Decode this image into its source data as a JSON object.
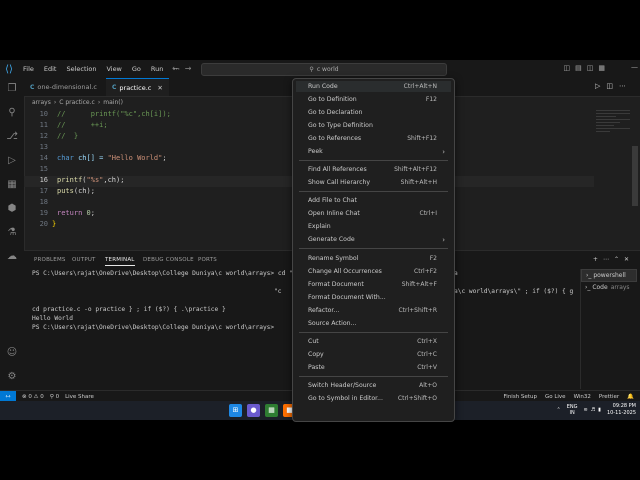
{
  "titlebar": {
    "menus": [
      "File",
      "Edit",
      "Selection",
      "View",
      "Go",
      "Run",
      "⋯"
    ],
    "search_text": "c world"
  },
  "tabs": [
    {
      "label": "one-dimensional.c"
    },
    {
      "label": "practice.c",
      "active": true
    }
  ],
  "breadcrumb": [
    "arrays",
    "C practice.c",
    "main()"
  ],
  "editor": {
    "lines": [
      {
        "num": "10",
        "html_key": "l10"
      },
      {
        "num": "11",
        "html_key": "l11"
      },
      {
        "num": "12",
        "html_key": "l12"
      },
      {
        "num": "13",
        "html_key": "l13"
      },
      {
        "num": "14",
        "html_key": "l14"
      },
      {
        "num": "15",
        "html_key": "l15"
      },
      {
        "num": "16",
        "html_key": "l16"
      },
      {
        "num": "17",
        "html_key": "l17"
      },
      {
        "num": "18",
        "html_key": "l18"
      },
      {
        "num": "19",
        "html_key": "l19"
      },
      {
        "num": "20",
        "html_key": "l20"
      }
    ],
    "code": {
      "l10": "//      printf(\"%c\",ch[i]);",
      "l11": "//      ++i;",
      "l12": "//  }",
      "l14_kw": "char",
      "l14_rest": " ch[] = ",
      "l14_str": "\"Hello World\"",
      "l14_end": ";",
      "l16_fn": "printf",
      "l16_a": "(",
      "l16_str": "\"%s\"",
      "l16_b": ",ch);",
      "l17_fn": "puts",
      "l17_b": "(ch);",
      "l19_kw": "return",
      "l19_num": "0",
      "l19_end": ";",
      "l20": "}"
    }
  },
  "panel": {
    "tabs": [
      "PROBLEMS",
      "OUTPUT",
      "TERMINAL",
      "DEBUG CONSOLE",
      "PORTS"
    ],
    "active_tab": "TERMINAL",
    "terminal_lines": [
      "PS C:\\Users\\rajat\\OneDrive\\Desktop\\College Duniya\\c world\\arrays> cd \"c",
      "a",
      "\"c",
      "a\\c world\\arrays\\\" ; if ($?) { g",
      "cd practice.c -o practice } ; if ($?) { .\\practice }",
      "Hello World",
      "PS C:\\Users\\rajat\\OneDrive\\Desktop\\College Duniya\\c world\\arrays> "
    ],
    "terminals": [
      {
        "label": "powershell",
        "sub": ""
      },
      {
        "label": "Code",
        "sub": "arrays"
      }
    ]
  },
  "statusbar": {
    "left": [
      "⊗ 0 ⚠ 0",
      "⚲ 0",
      "Live Share"
    ],
    "right": [
      "Finish Setup",
      "Go Live",
      "Win32",
      "Prettier"
    ]
  },
  "taskbar": {
    "lang": [
      "ENG",
      "IN"
    ],
    "time": "09:28 PM",
    "date": "10-11-2025"
  },
  "context_menu": {
    "items": [
      {
        "label": "Run Code",
        "shortcut": "Ctrl+Alt+N"
      },
      {
        "label": "Go to Definition",
        "shortcut": "F12"
      },
      {
        "label": "Go to Declaration",
        "shortcut": ""
      },
      {
        "label": "Go to Type Definition",
        "shortcut": ""
      },
      {
        "label": "Go to References",
        "shortcut": "Shift+F12"
      },
      {
        "label": "Peek",
        "shortcut": "",
        "submenu": true
      },
      {
        "label": "Find All References",
        "shortcut": "Shift+Alt+F12"
      },
      {
        "label": "Show Call Hierarchy",
        "shortcut": "Shift+Alt+H"
      },
      {
        "label": "Add File to Chat",
        "shortcut": ""
      },
      {
        "label": "Open Inline Chat",
        "shortcut": "Ctrl+I"
      },
      {
        "label": "Explain",
        "shortcut": ""
      },
      {
        "label": "Generate Code",
        "shortcut": "",
        "submenu": true
      },
      {
        "label": "Rename Symbol",
        "shortcut": "F2"
      },
      {
        "label": "Change All Occurrences",
        "shortcut": "Ctrl+F2"
      },
      {
        "label": "Format Document",
        "shortcut": "Shift+Alt+F"
      },
      {
        "label": "Format Document With...",
        "shortcut": ""
      },
      {
        "label": "Refactor...",
        "shortcut": "Ctrl+Shift+R"
      },
      {
        "label": "Source Action...",
        "shortcut": ""
      },
      {
        "label": "Cut",
        "shortcut": "Ctrl+X"
      },
      {
        "label": "Copy",
        "shortcut": "Ctrl+C"
      },
      {
        "label": "Paste",
        "shortcut": "Ctrl+V"
      },
      {
        "label": "Switch Header/Source",
        "shortcut": "Alt+O"
      },
      {
        "label": "Go to Symbol in Editor...",
        "shortcut": "Ctrl+Shift+O"
      }
    ]
  },
  "colors": {
    "accent": "#0078d4",
    "editor_bg": "#1f1f1f",
    "panel_bg": "#181818"
  }
}
